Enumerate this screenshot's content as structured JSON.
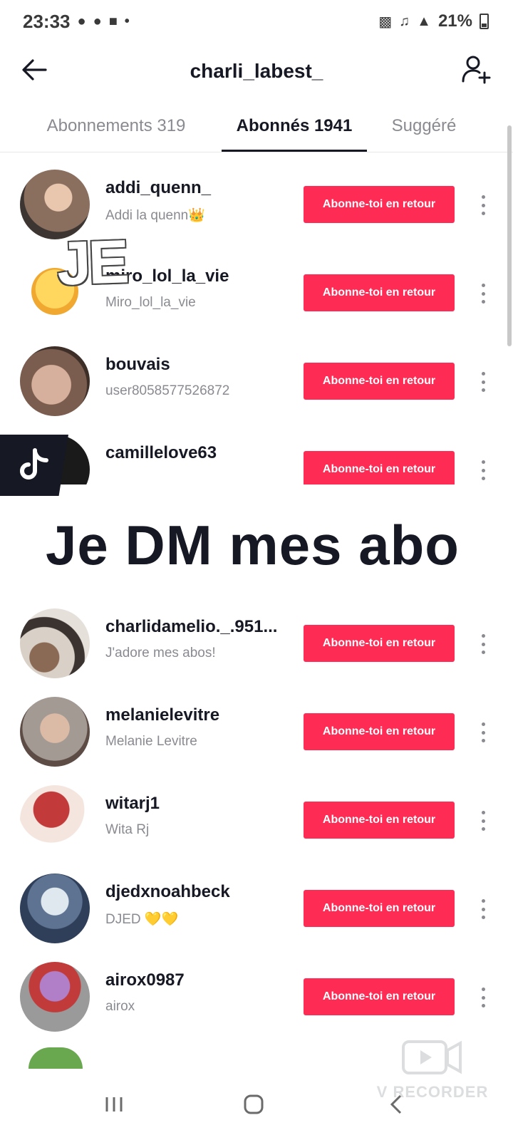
{
  "status": {
    "time": "23:33",
    "battery": "21%"
  },
  "header": {
    "title": "charli_labest_"
  },
  "tabs": [
    {
      "label": "Abonnements 319"
    },
    {
      "label": "Abonnés 1941"
    },
    {
      "label": "Suggéré"
    }
  ],
  "follow_button_label": "Abonne-toi en retour",
  "followers": [
    {
      "username": "addi_quenn_",
      "nickname": "Addi la quenn👑",
      "avatar_color": "#8a6e5e"
    },
    {
      "username": "miro_lol_la_vie",
      "nickname": "Miro_lol_la_vie",
      "avatar_color": "#f7c948"
    },
    {
      "username": "bouvais",
      "nickname": "user8058577526872",
      "avatar_color": "#7a5d4e"
    },
    {
      "username": "camillelove63",
      "nickname": "",
      "avatar_color": "#1a1a1a"
    },
    {
      "username": "charlidamelio._.951...",
      "nickname": "J'adore mes abos!",
      "avatar_color": "#d9d0c7"
    },
    {
      "username": "melanielevitre",
      "nickname": "Melanie Levitre",
      "avatar_color": "#a39a94"
    },
    {
      "username": "witarj1",
      "nickname": "Wita Rj",
      "avatar_color": "#c23a3a"
    },
    {
      "username": "djedxnoahbeck",
      "nickname": "DJED 💛💛",
      "avatar_color": "#2f3f5a"
    },
    {
      "username": "airox0987",
      "nickname": "airox",
      "avatar_color": "#b07fc8"
    }
  ],
  "overlay": {
    "caption": "Je DM mes abo",
    "sticker": "JE"
  },
  "watermark": "V RECORDER",
  "colors": {
    "accent": "#fe2c55",
    "text": "#161823",
    "muted": "#8a8b91"
  }
}
